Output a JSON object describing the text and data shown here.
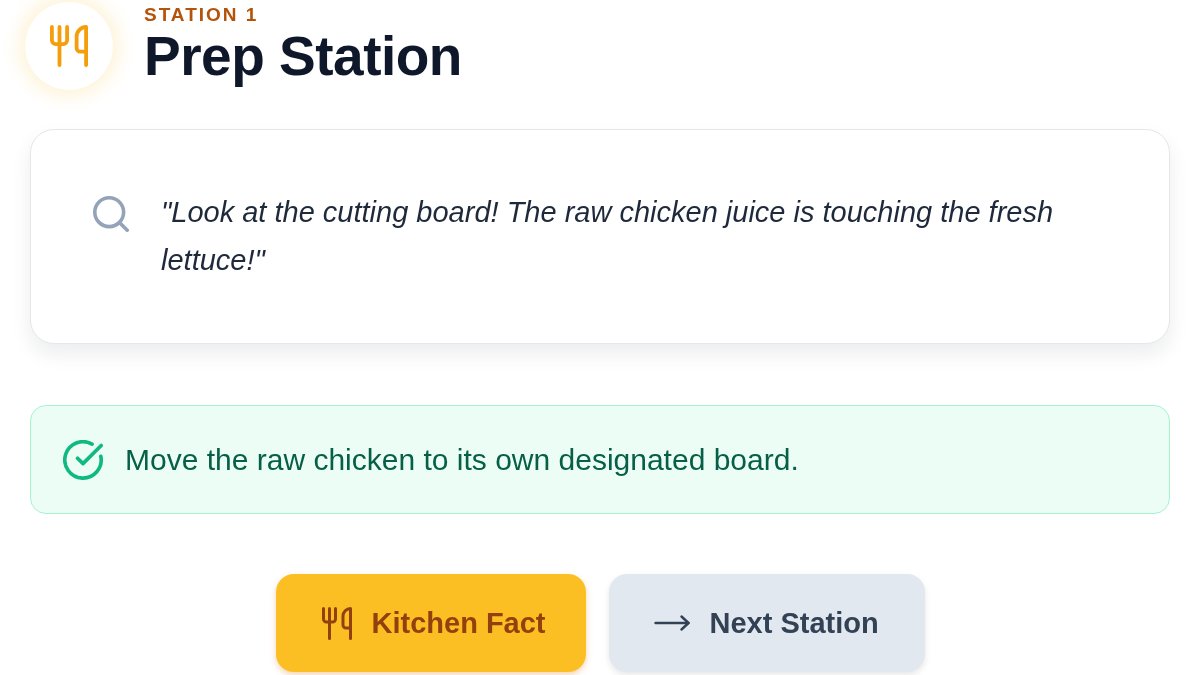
{
  "station": {
    "label": "STATION 1",
    "title": "Prep Station"
  },
  "scenario": {
    "quote": "\"Look at the cutting board! The raw chicken juice is touching the fresh lettuce!\""
  },
  "solution": {
    "text": "Move the raw chicken to its own designated board."
  },
  "buttons": [
    {
      "label": "Kitchen Fact",
      "kind": "fact"
    },
    {
      "label": "Next Station",
      "kind": "next"
    }
  ]
}
